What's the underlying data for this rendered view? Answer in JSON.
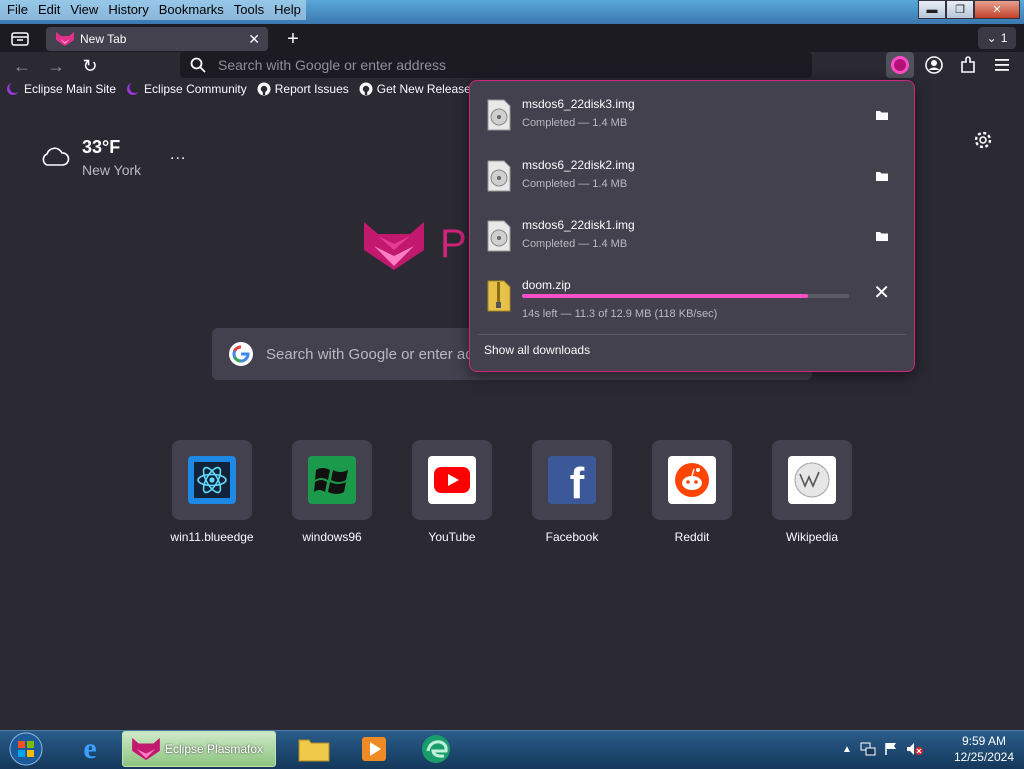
{
  "menu": [
    "File",
    "Edit",
    "View",
    "History",
    "Bookmarks",
    "Tools",
    "Help"
  ],
  "window_controls": {
    "minimize": "▬",
    "maximize": "❐",
    "close": "✕"
  },
  "tab": {
    "title": "New Tab",
    "close": "✕",
    "new_tab": "+",
    "count": "1"
  },
  "address_bar": {
    "placeholder": "Search with Google or enter address"
  },
  "bookmarks": [
    {
      "label": "Eclipse Main Site",
      "icon": "eclipse-icon"
    },
    {
      "label": "Eclipse Community",
      "icon": "eclipse-icon"
    },
    {
      "label": "Report Issues",
      "icon": "github-icon"
    },
    {
      "label": "Get New Releases",
      "icon": "github-icon"
    }
  ],
  "weather": {
    "temperature": "33°F",
    "city": "New York",
    "menu": "..."
  },
  "logo_text": "P",
  "main_search": {
    "placeholder": "Search with Google or enter address"
  },
  "top_sites": [
    {
      "label": "win11.blueedge",
      "icon": "react-icon"
    },
    {
      "label": "windows96",
      "icon": "windows-flag-icon"
    },
    {
      "label": "YouTube",
      "icon": "youtube-icon"
    },
    {
      "label": "Facebook",
      "icon": "facebook-icon"
    },
    {
      "label": "Reddit",
      "icon": "reddit-icon"
    },
    {
      "label": "Wikipedia",
      "icon": "wikipedia-icon"
    }
  ],
  "downloads": {
    "items": [
      {
        "name": "msdos6_22disk3.img",
        "status": "Completed — 1.4 MB"
      },
      {
        "name": "msdos6_22disk2.img",
        "status": "Completed — 1.4 MB"
      },
      {
        "name": "msdos6_22disk1.img",
        "status": "Completed — 1.4 MB"
      }
    ],
    "active": {
      "name": "doom.zip",
      "status": "14s left — 11.3 of 12.9 MB (118 KB/sec)",
      "progress": 0.876
    },
    "show_all": "Show all downloads"
  },
  "taskbar": {
    "active_app": "Eclipse Plasmafox"
  },
  "clock": {
    "time": "9:59 AM",
    "date": "12/25/2024"
  },
  "colors": {
    "accent": "#ff4fc8",
    "panel_border": "#d0257a",
    "background": "#2b2a33"
  }
}
